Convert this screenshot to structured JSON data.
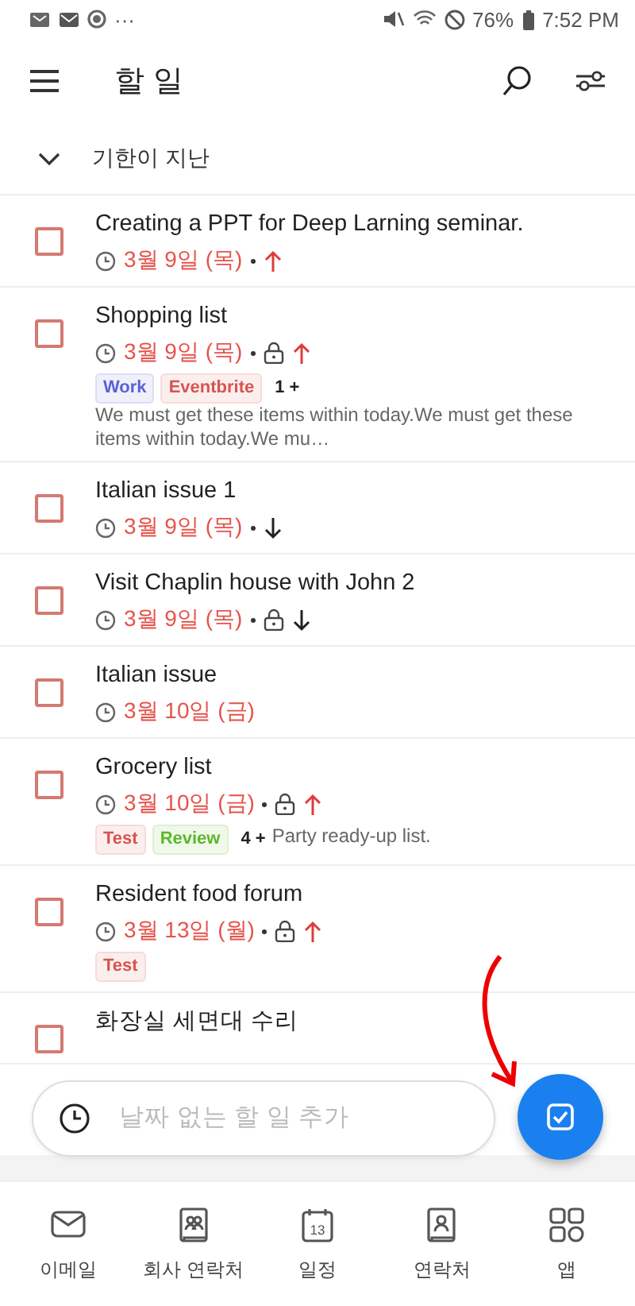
{
  "status_bar": {
    "more": "···",
    "battery": "76%",
    "time": "7:52 PM"
  },
  "header": {
    "title": "할 일"
  },
  "section": {
    "title": "기한이 지난",
    "expanded": true
  },
  "tasks": [
    {
      "title": "Creating a PPT for Deep Larning seminar.",
      "checked": false,
      "due": "3월 9일 (목)",
      "overdue": true,
      "locked": false,
      "high_priority": true,
      "low_priority": false
    },
    {
      "title": "Shopping list",
      "checked": false,
      "due": "3월 9일 (목)",
      "overdue": true,
      "locked": true,
      "high_priority": true,
      "low_priority": false,
      "tags": [
        {
          "label": "Work",
          "color": "#5b5fd6"
        },
        {
          "label": "Eventbrite",
          "color": "#d9534f"
        }
      ],
      "count": "1 +",
      "note": "We must get these items within today.We must get these items within today.We mu…"
    },
    {
      "title": "Italian issue 1",
      "checked": false,
      "due": "3월 9일 (목)",
      "overdue": true,
      "locked": false,
      "high_priority": false,
      "low_priority": true
    },
    {
      "title": "Visit Chaplin house with John 2",
      "checked": false,
      "due": "3월 9일 (목)",
      "overdue": true,
      "locked": true,
      "high_priority": false,
      "low_priority": true
    },
    {
      "title": "Italian issue",
      "checked": false,
      "due": "3월 10일 (금)",
      "overdue": true,
      "locked": false,
      "high_priority": false,
      "low_priority": false
    },
    {
      "title": "Grocery list",
      "checked": false,
      "due": "3월 10일 (금)",
      "overdue": true,
      "locked": true,
      "high_priority": true,
      "low_priority": false,
      "tags": [
        {
          "label": "Test",
          "color": "#d9534f"
        },
        {
          "label": "Review",
          "color": "#5cb82a"
        }
      ],
      "count": "4 +",
      "note": "Party ready-up list."
    },
    {
      "title": "Resident food forum",
      "checked": false,
      "due": "3월 13일 (월)",
      "overdue": true,
      "locked": true,
      "high_priority": true,
      "low_priority": false,
      "tags": [
        {
          "label": "Test",
          "color": "#d9534f"
        }
      ]
    },
    {
      "title": "화장실 세면대 수리",
      "checked": false
    }
  ],
  "quick_add": {
    "placeholder": "날짜 없는 할 일 추가"
  },
  "nav": [
    {
      "kind": "mail",
      "label": "이메일"
    },
    {
      "kind": "company",
      "label": "회사 연락처"
    },
    {
      "kind": "calendar",
      "label": "일정",
      "icon_text": "13"
    },
    {
      "kind": "contacts",
      "label": "연락처"
    },
    {
      "kind": "apps",
      "label": "앱"
    }
  ]
}
